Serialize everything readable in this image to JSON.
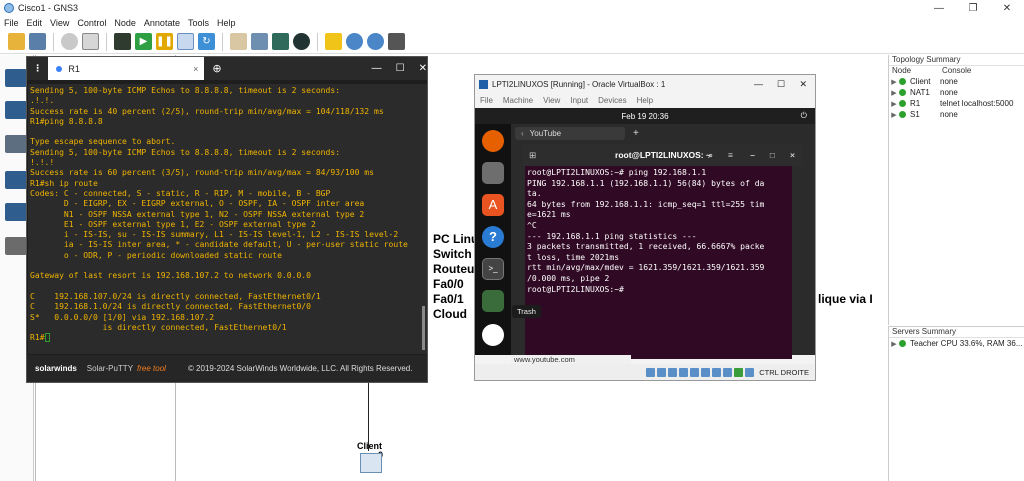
{
  "gns3": {
    "title": "Cisco1 - GNS3",
    "menu": [
      "File",
      "Edit",
      "View",
      "Control",
      "Node",
      "Annotate",
      "Tools",
      "Help"
    ]
  },
  "canvas": {
    "text_lines": [
      "PC Linu",
      "Switch",
      "Routeu",
      "Fa0/0",
      "Fa0/1",
      "Cloud"
    ],
    "side_text": "lique via I",
    "client_label": "Client",
    "client_iface": "e0"
  },
  "topology": {
    "title": "Topology Summary",
    "col_node": "Node",
    "col_console": "Console",
    "rows": [
      {
        "node": "Client",
        "console": "none"
      },
      {
        "node": "NAT1",
        "console": "none"
      },
      {
        "node": "R1",
        "console": "telnet localhost:5000"
      },
      {
        "node": "S1",
        "console": "none"
      }
    ]
  },
  "servers": {
    "title": "Servers Summary",
    "row": "Teacher CPU 33.6%, RAM 36..."
  },
  "putty": {
    "tab_label": "R1",
    "brand": "solarwinds",
    "product": "Solar-PuTTY",
    "product_tag": "free tool",
    "copyright": "© 2019-2024 SolarWinds Worldwide, LLC. All Rights Reserved.",
    "terminal": "Sending 5, 100-byte ICMP Echos to 8.8.8.8, timeout is 2 seconds:\n.!.!.\nSuccess rate is 40 percent (2/5), round-trip min/avg/max = 104/118/132 ms\nR1#ping 8.8.8.8\n\nType escape sequence to abort.\nSending 5, 100-byte ICMP Echos to 8.8.8.8, timeout is 2 seconds:\n!.!.!\nSuccess rate is 60 percent (3/5), round-trip min/avg/max = 84/93/100 ms\nR1#sh ip route\nCodes: C - connected, S - static, R - RIP, M - mobile, B - BGP\n       D - EIGRP, EX - EIGRP external, O - OSPF, IA - OSPF inter area\n       N1 - OSPF NSSA external type 1, N2 - OSPF NSSA external type 2\n       E1 - OSPF external type 1, E2 - OSPF external type 2\n       i - IS-IS, su - IS-IS summary, L1 - IS-IS level-1, L2 - IS-IS level-2\n       ia - IS-IS inter area, * - candidate default, U - per-user static route\n       o - ODR, P - periodic downloaded static route\n\nGateway of last resort is 192.168.107.2 to network 0.0.0.0\n\nC    192.168.107.0/24 is directly connected, FastEthernet0/1\nC    192.168.1.0/24 is directly connected, FastEthernet0/0\nS*   0.0.0.0/0 [1/0] via 192.168.107.2\n               is directly connected, FastEthernet0/1\nR1#"
  },
  "vbox": {
    "title": "LPTI2LINUXOS [Running] - Oracle VirtualBox : 1",
    "menu": [
      "File",
      "Machine",
      "View",
      "Input",
      "Devices",
      "Help"
    ],
    "clock": "Feb 19  20:36",
    "browser_tab": "YouTube",
    "term_title": "root@LPTI2LINUXOS: ~",
    "terminal": "root@LPTI2LINUXOS:~# ping 192.168.1.1\nPING 192.168.1.1 (192.168.1.1) 56(84) bytes of da\nta.\n64 bytes from 192.168.1.1: icmp_seq=1 ttl=255 tim\ne=1621 ms\n^C\n--- 192.168.1.1 ping statistics ---\n3 packets transmitted, 1 received, 66.6667% packe\nt loss, time 2021ms\nrtt min/avg/max/mdev = 1621.359/1621.359/1621.359\n/0.000 ms, pipe 2\nroot@LPTI2LINUXOS:~# ",
    "status_url": "www.youtube.com",
    "host_key": "CTRL DROITE",
    "trash_tooltip": "Trash"
  }
}
